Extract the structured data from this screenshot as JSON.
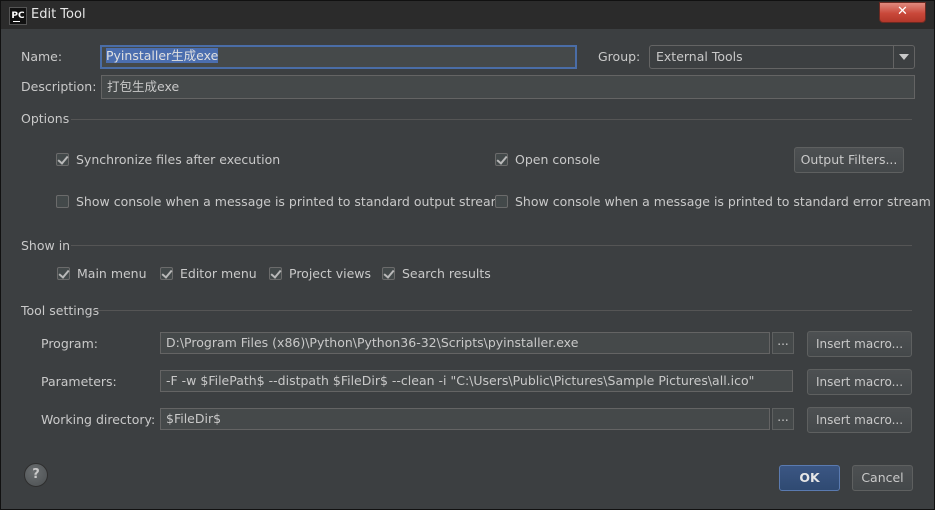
{
  "window": {
    "title": "Edit Tool",
    "close_glyph": "✕",
    "app_icon": "PC"
  },
  "form": {
    "name_label": "Name:",
    "name_value": "Pyinstaller生成exe",
    "group_label": "Group:",
    "group_value": "External Tools",
    "description_label": "Description:",
    "description_value": "打包生成exe"
  },
  "options": {
    "title": "Options",
    "sync_files": {
      "label": "Synchronize files after execution",
      "checked": true
    },
    "open_console": {
      "label": "Open console",
      "checked": true
    },
    "output_filters_label": "Output Filters...",
    "show_console_stdout": {
      "label": "Show console when a message is printed to standard output stream",
      "checked": false
    },
    "show_console_stderr": {
      "label": "Show console when a message is printed to standard error stream",
      "checked": false
    }
  },
  "show_in": {
    "title": "Show in",
    "items": [
      {
        "label": "Main menu",
        "checked": true
      },
      {
        "label": "Editor menu",
        "checked": true
      },
      {
        "label": "Project views",
        "checked": true
      },
      {
        "label": "Search results",
        "checked": true
      }
    ]
  },
  "tool_settings": {
    "title": "Tool settings",
    "program_label": "Program:",
    "program_value": "D:\\Program Files (x86)\\Python\\Python36-32\\Scripts\\pyinstaller.exe",
    "parameters_label": "Parameters:",
    "parameters_value": "-F -w $FilePath$ --distpath $FileDir$ --clean -i \"C:\\Users\\Public\\Pictures\\Sample Pictures\\all.ico\"",
    "working_dir_label": "Working directory:",
    "working_dir_value": "$FileDir$",
    "insert_macro_label": "Insert macro...",
    "browse_label": "..."
  },
  "footer": {
    "help_glyph": "?",
    "ok_label": "OK",
    "cancel_label": "Cancel"
  }
}
